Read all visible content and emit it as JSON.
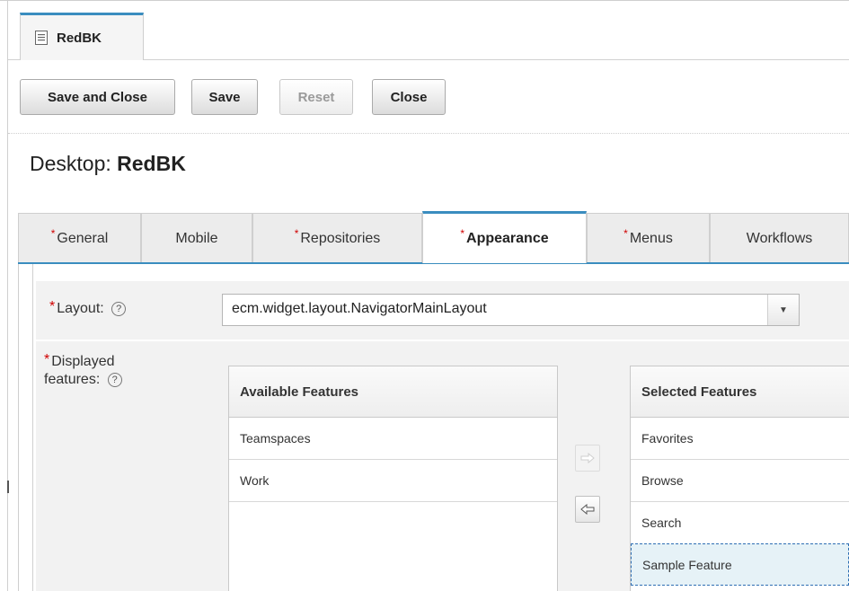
{
  "document_tab": {
    "label": "RedBK",
    "icon": "document-icon"
  },
  "toolbar": {
    "save_and_close": "Save and Close",
    "save": "Save",
    "reset": "Reset",
    "close": "Close"
  },
  "page": {
    "title_prefix": "Desktop: ",
    "title_name": "RedBK"
  },
  "tabs": [
    {
      "label": "General",
      "required": true,
      "active": false
    },
    {
      "label": "Mobile",
      "required": false,
      "active": false
    },
    {
      "label": "Repositories",
      "required": true,
      "active": false
    },
    {
      "label": "Appearance",
      "required": true,
      "active": true
    },
    {
      "label": "Menus",
      "required": true,
      "active": false
    },
    {
      "label": "Workflows",
      "required": false,
      "active": false
    }
  ],
  "required_marker": "*",
  "layout_field": {
    "label": "Layout:",
    "help": "?",
    "value": "ecm.widget.layout.NavigatorMainLayout"
  },
  "features_field": {
    "label_line1": "Displayed",
    "label_line2": "features:",
    "help": "?",
    "available_header": "Available Features",
    "available_items": [
      "Teamspaces",
      "Work"
    ],
    "selected_header": "Selected Features",
    "selected_items": [
      "Favorites",
      "Browse",
      "Search",
      "Sample Feature"
    ],
    "focused_item": "Sample Feature"
  },
  "colors": {
    "accent": "#3a8dbf",
    "required": "#d00000",
    "focus_border": "#2f6fb3"
  }
}
